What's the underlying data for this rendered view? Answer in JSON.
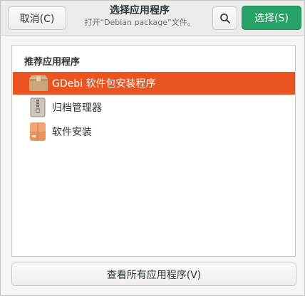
{
  "header": {
    "cancel_label": "取消(C)",
    "title": "选择应用程序",
    "subtitle": "打开“Debian package”文件。",
    "search_icon": "search-icon",
    "select_label": "选择(S)",
    "accent_color": "#26a269"
  },
  "list": {
    "section_title": "推荐应用程序",
    "selection_color": "#e95420",
    "apps": [
      {
        "label": "GDebi 软件包安装程序",
        "icon": "package-box-icon",
        "selected": true
      },
      {
        "label": "归档管理器",
        "icon": "archive-manager-icon",
        "selected": false
      },
      {
        "label": "软件安装",
        "icon": "software-install-icon",
        "selected": false
      }
    ]
  },
  "footer": {
    "view_all_label": "查看所有应用程序(V)"
  }
}
